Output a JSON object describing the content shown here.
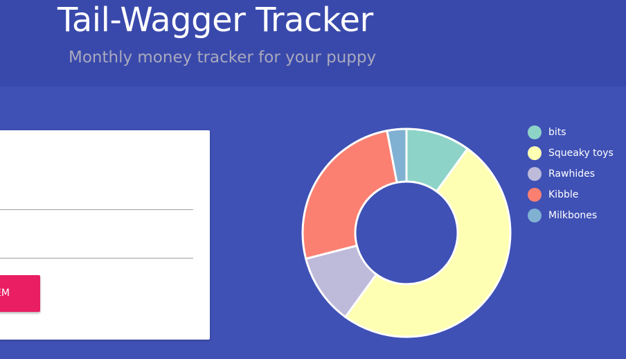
{
  "header": {
    "title": "Tail-Wagger Tracker",
    "subtitle": "Monthly money tracker for your puppy"
  },
  "form": {
    "item_name_value": "",
    "item_cost_value": "",
    "add_button_label": "ADD ITEM"
  },
  "colors": {
    "background": "#3f51b5",
    "header": "#3949ab",
    "button": "#e91e63"
  },
  "chart_data": {
    "type": "pie",
    "style": "doughnut",
    "categories": [
      "bits",
      "Squeaky toys",
      "Rawhides",
      "Kibble",
      "Milkbones"
    ],
    "values": [
      10,
      50,
      11,
      26,
      3
    ],
    "colors": [
      "#8dd3c7",
      "#ffffb3",
      "#bebada",
      "#fb8072",
      "#80b1d3"
    ],
    "legend": "right"
  }
}
